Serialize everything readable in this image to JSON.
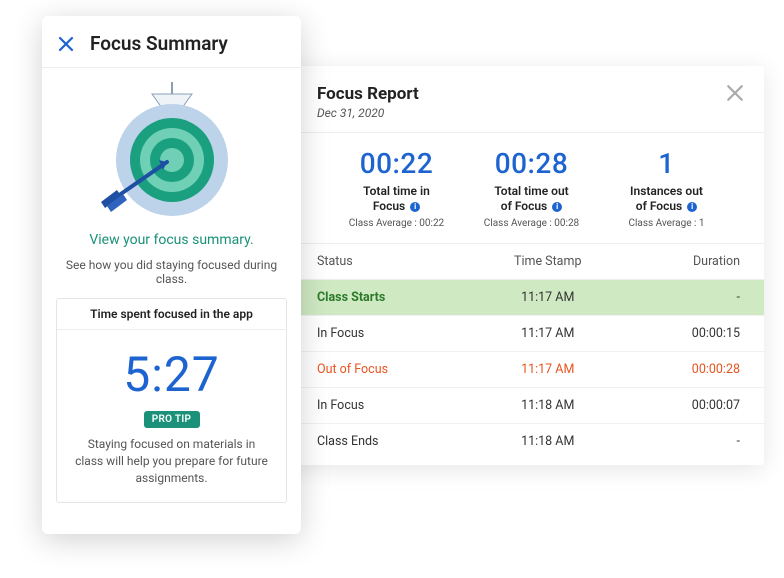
{
  "summary": {
    "title": "Focus Summary",
    "view_link": "View your focus summary.",
    "subtext": "See how you did staying focused during class.",
    "time_box": {
      "header": "Time spent focused in the app",
      "value": "5:27",
      "pro_tip_badge": "PRO TIP",
      "tip_text": "Staying focused on materials in class will help you prepare for future assignments."
    }
  },
  "report": {
    "title": "Focus Report",
    "date": "Dec 31, 2020",
    "metrics": [
      {
        "value": "00:22",
        "label_line1": "Total time in",
        "label_line2": "Focus",
        "avg_label": "Class Average : 00:22"
      },
      {
        "value": "00:28",
        "label_line1": "Total time out",
        "label_line2": "of Focus",
        "avg_label": "Class Average : 00:28"
      },
      {
        "value": "1",
        "label_line1": "Instances out",
        "label_line2": "of Focus",
        "avg_label": "Class Average : 1"
      }
    ],
    "columns": {
      "status": "Status",
      "time": "Time Stamp",
      "duration": "Duration"
    },
    "rows": [
      {
        "status": "Class Starts",
        "time": "11:17 AM",
        "duration": "-",
        "variant": "start"
      },
      {
        "status": "In Focus",
        "time": "11:17 AM",
        "duration": "00:00:15",
        "variant": "in"
      },
      {
        "status": "Out of Focus",
        "time": "11:17 AM",
        "duration": "00:00:28",
        "variant": "out"
      },
      {
        "status": "In Focus",
        "time": "11:18 AM",
        "duration": "00:00:07",
        "variant": "in"
      },
      {
        "status": "Class Ends",
        "time": "11:18 AM",
        "duration": "-",
        "variant": "end"
      }
    ]
  }
}
